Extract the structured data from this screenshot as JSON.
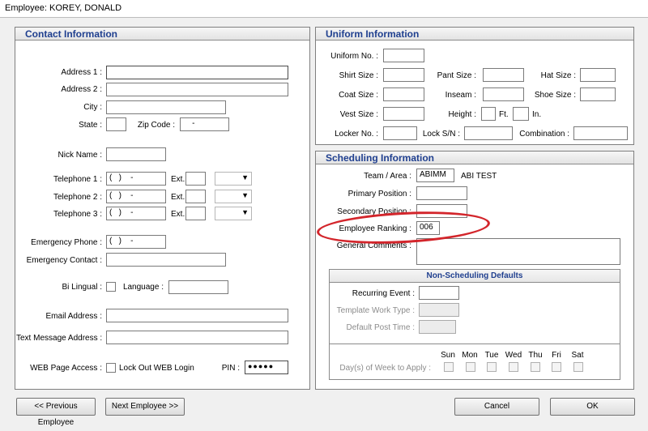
{
  "window": {
    "title": "Employee:  KOREY, DONALD"
  },
  "contact": {
    "title": "Contact Information",
    "address1_label": "Address 1 :",
    "address1": "",
    "address2_label": "Address 2 :",
    "address2": "",
    "city_label": "City :",
    "city": "",
    "state_label": "State :",
    "state": "",
    "zip_label": "Zip Code :",
    "zip": "    -",
    "nick_label": "Nick Name :",
    "nick": "",
    "tel1_label": "Telephone 1 :",
    "tel1": "(   )    -",
    "tel2_label": "Telephone 2 :",
    "tel2": "(   )    -",
    "tel3_label": "Telephone 3 :",
    "tel3": "(   )    -",
    "ext_label": "Ext.",
    "emergency_phone_label": "Emergency Phone :",
    "emergency_phone": "(   )    -",
    "emergency_contact_label": "Emergency Contact :",
    "emergency_contact": "",
    "bilingual_label": "Bi Lingual :",
    "language_label": "Language :",
    "language": "",
    "email_label": "Email Address :",
    "email": "",
    "text_label": "Text Message Address :",
    "text": "",
    "web_label": "WEB Page Access :",
    "lockout_label": "Lock Out WEB Login",
    "pin_label": "PIN :",
    "pin": "●●●●●"
  },
  "uniform": {
    "title": "Uniform Information",
    "uniform_no_label": "Uniform No. :",
    "shirt_label": "Shirt Size :",
    "pant_label": "Pant Size :",
    "hat_label": "Hat Size :",
    "coat_label": "Coat Size :",
    "inseam_label": "Inseam :",
    "shoe_label": "Shoe Size :",
    "vest_label": "Vest Size :",
    "height_label": "Height :",
    "ft_label": "Ft.",
    "in_label": "In.",
    "locker_label": "Locker No. :",
    "lock_sn_label": "Lock S/N :",
    "combination_label": "Combination :"
  },
  "scheduling": {
    "title": "Scheduling Information",
    "team_label": "Team / Area :",
    "team_code": "ABIMM",
    "team_name": "ABI TEST",
    "primary_label": "Primary Position :",
    "secondary_label": "Secondary Position :",
    "ranking_label": "Employee Ranking :",
    "ranking": "006",
    "comments_label": "General Comments :"
  },
  "nonsched": {
    "title": "Non-Scheduling Defaults",
    "recurring_label": "Recurring Event :",
    "template_label": "Template Work Type :",
    "default_post_label": "Default Post Time :",
    "days_label": "Day(s) of Week to Apply :",
    "days": [
      "Sun",
      "Mon",
      "Tue",
      "Wed",
      "Thu",
      "Fri",
      "Sat"
    ]
  },
  "buttons": {
    "prev": "<< Previous Employee",
    "next": "Next Employee >>",
    "cancel": "Cancel",
    "ok": "OK"
  },
  "colors": {
    "header_text": "#1f3f8f",
    "annotation": "#d3252b"
  }
}
